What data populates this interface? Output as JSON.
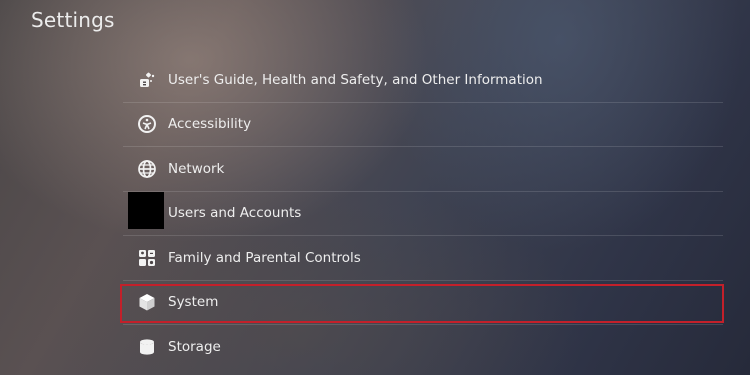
{
  "header": {
    "title": "Settings"
  },
  "menu": {
    "items": [
      {
        "label": "User's Guide, Health and Safety, and Other Information",
        "icon": "guide-icon"
      },
      {
        "label": "Accessibility",
        "icon": "accessibility-icon"
      },
      {
        "label": "Network",
        "icon": "globe-icon"
      },
      {
        "label": "Users and Accounts",
        "icon": "user-avatar"
      },
      {
        "label": "Family and Parental Controls",
        "icon": "family-icon"
      },
      {
        "label": "System",
        "icon": "cube-icon",
        "highlighted": true
      },
      {
        "label": "Storage",
        "icon": "storage-icon"
      }
    ]
  },
  "colors": {
    "highlight_border": "#c3202a",
    "text": "#eeeeee"
  }
}
